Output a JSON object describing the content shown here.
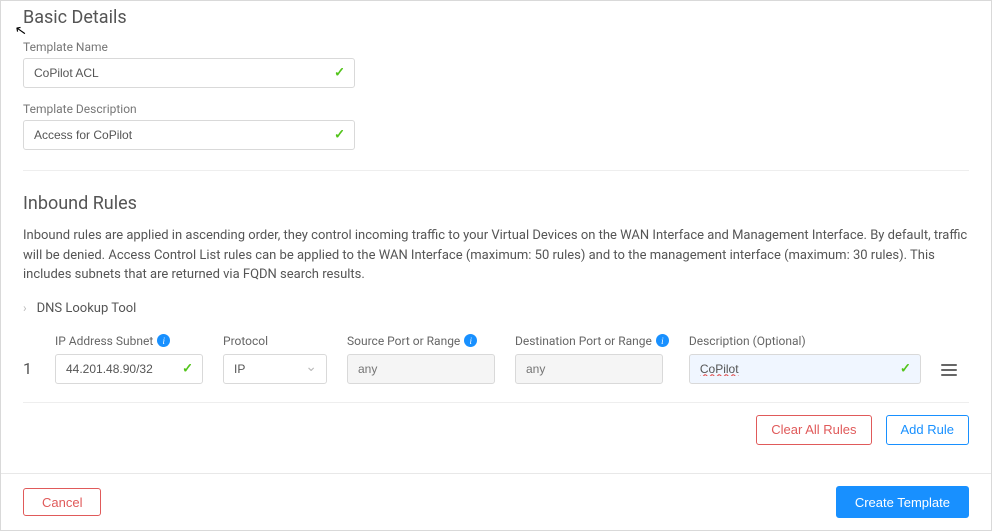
{
  "basic": {
    "title": "Basic Details",
    "templateNameLabel": "Template Name",
    "templateNameValue": "CoPilot ACL",
    "templateDescLabel": "Template Description",
    "templateDescValue": "Access for CoPilot"
  },
  "inbound": {
    "title": "Inbound Rules",
    "description": "Inbound rules are applied in ascending order, they control incoming traffic to your Virtual Devices on the WAN Interface and Management Interface. By default, traffic will be denied. Access Control List rules can be applied to the WAN Interface (maximum: 50 rules) and to the management interface (maximum: 30 rules). This includes subnets that are returned via FQDN search results.",
    "dnsTool": "DNS Lookup Tool",
    "columns": {
      "ipSubnet": "IP Address Subnet",
      "protocol": "Protocol",
      "sourcePort": "Source Port or Range",
      "destPort": "Destination Port or Range",
      "description": "Description (Optional)"
    },
    "rule1": {
      "index": "1",
      "ipSubnet": "44.201.48.90/32",
      "protocol": "IP",
      "sourcePlaceholder": "any",
      "destPlaceholder": "any",
      "description": "CoPilot"
    },
    "clearAll": "Clear All Rules",
    "addRule": "Add Rule"
  },
  "footer": {
    "cancel": "Cancel",
    "create": "Create Template"
  }
}
